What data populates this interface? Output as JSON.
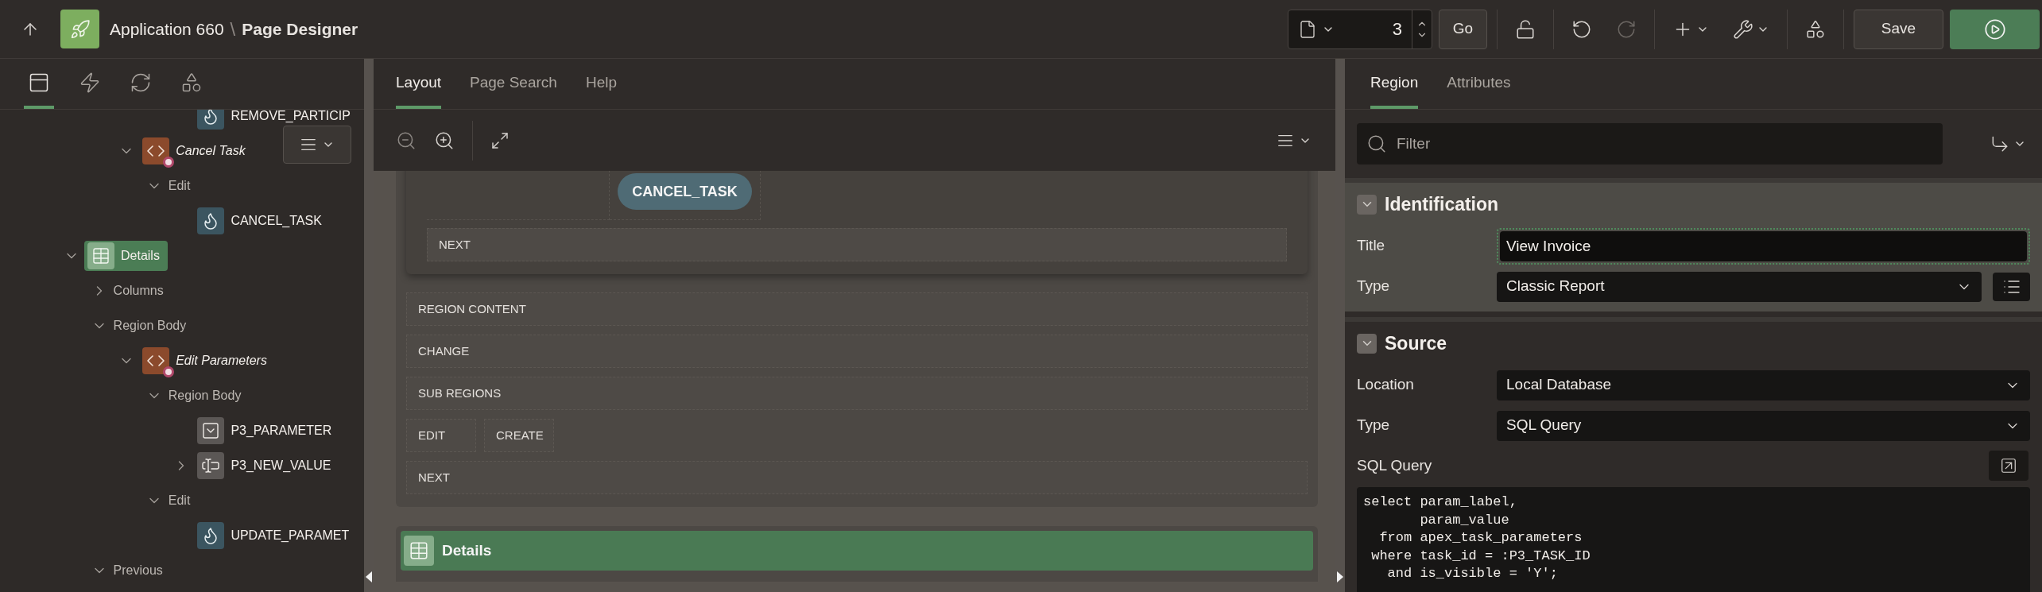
{
  "header": {
    "app": "Application 660",
    "separator": "\\",
    "page": "Page Designer"
  },
  "page_selector": {
    "value": "3"
  },
  "go": "Go",
  "toolbar_groups": [
    [
      {
        "kind": "unlock",
        "menu": false,
        "disabled": false
      }
    ],
    [
      {
        "kind": "undo",
        "menu": false,
        "disabled": false
      },
      {
        "kind": "redo",
        "menu": false,
        "disabled": true
      }
    ],
    [
      {
        "kind": "add",
        "menu": true,
        "disabled": false
      },
      {
        "kind": "utilities",
        "menu": true,
        "disabled": false
      }
    ],
    [
      {
        "kind": "shared",
        "menu": false,
        "disabled": false
      }
    ]
  ],
  "save": "Save",
  "left_tabs": [
    {
      "kind": "rendering",
      "selected": true
    },
    {
      "kind": "dynamic-actions",
      "selected": false
    },
    {
      "kind": "processing",
      "selected": false
    },
    {
      "kind": "shared",
      "selected": false
    }
  ],
  "tree": [
    {
      "children": [
        {
          "children": [
            {
              "children": [
                {
                  "children": [
                    {
                      "label": "REMOVE_PARTICIP",
                      "kind": "process",
                      "selected": false
                    }
                  ]
                }
              ]
            },
            {
              "label": "Cancel Task",
              "kind": "dynamic-action",
              "expanded": true,
              "selected": false,
              "children": [
                {
                  "label": "Edit",
                  "kind": "group",
                  "expanded": true,
                  "selected": false,
                  "children": [
                    {
                      "label": "CANCEL_TASK",
                      "kind": "process",
                      "selected": false
                    }
                  ]
                }
              ]
            }
          ]
        }
      ]
    },
    {
      "label": "Details",
      "kind": "report",
      "expanded": true,
      "selected": true,
      "children": [
        {
          "label": "Columns",
          "kind": "group",
          "expanded": false,
          "selected": false
        },
        {
          "label": "Region Body",
          "kind": "group",
          "expanded": true,
          "selected": false,
          "children": [
            {
              "label": "Edit Parameters",
              "kind": "dynamic-action",
              "expanded": true,
              "selected": false,
              "children": [
                {
                  "label": "Region Body",
                  "kind": "group",
                  "expanded": true,
                  "selected": false,
                  "children": [
                    {
                      "label": "P3_PARAMETER",
                      "kind": "select-list",
                      "selected": false
                    },
                    {
                      "label": "P3_NEW_VALUE",
                      "kind": "text-field",
                      "expanded": false,
                      "selected": false
                    }
                  ]
                },
                {
                  "label": "Edit",
                  "kind": "group",
                  "expanded": true,
                  "selected": false,
                  "children": [
                    {
                      "label": "UPDATE_PARAMET",
                      "kind": "process",
                      "selected": false
                    }
                  ]
                }
              ]
            }
          ]
        },
        {
          "label": "Previous",
          "kind": "group",
          "expanded": true,
          "selected": false
        }
      ]
    }
  ],
  "center_tabs": [
    {
      "label": "Layout",
      "selected": true
    },
    {
      "label": "Page Search",
      "selected": false
    },
    {
      "label": "Help",
      "selected": false
    }
  ],
  "layout": {
    "button": "CANCEL_TASK",
    "inner_row": "NEXT",
    "rows": [
      [
        "REGION CONTENT"
      ],
      [
        "CHANGE"
      ],
      [
        "SUB REGIONS"
      ],
      [
        "EDIT",
        "CREATE"
      ],
      [
        "NEXT"
      ]
    ],
    "region": "Details"
  },
  "property_tabs": [
    {
      "label": "Region",
      "selected": true
    },
    {
      "label": "Attributes",
      "selected": false
    }
  ],
  "filter": {
    "placeholder": "Filter"
  },
  "sections": [
    {
      "title": "Identification",
      "current": true,
      "expanded": true,
      "fields": [
        {
          "label": "Title",
          "kind": "text",
          "value": "View Invoice",
          "focused": true
        },
        {
          "label": "Type",
          "kind": "select",
          "value": "Classic Report",
          "list_button": true
        }
      ]
    },
    {
      "title": "Source",
      "current": false,
      "expanded": true,
      "fields": [
        {
          "label": "Location",
          "kind": "select",
          "value": "Local Database",
          "list_button": false
        },
        {
          "label": "Type",
          "kind": "select",
          "value": "SQL Query",
          "list_button": false
        },
        {
          "label": "SQL Query",
          "kind": "code",
          "value": "select param_label,\n       param_value\n  from apex_task_parameters\n where task_id = :P3_TASK_ID\n   and is_visible = 'Y';"
        }
      ]
    }
  ]
}
